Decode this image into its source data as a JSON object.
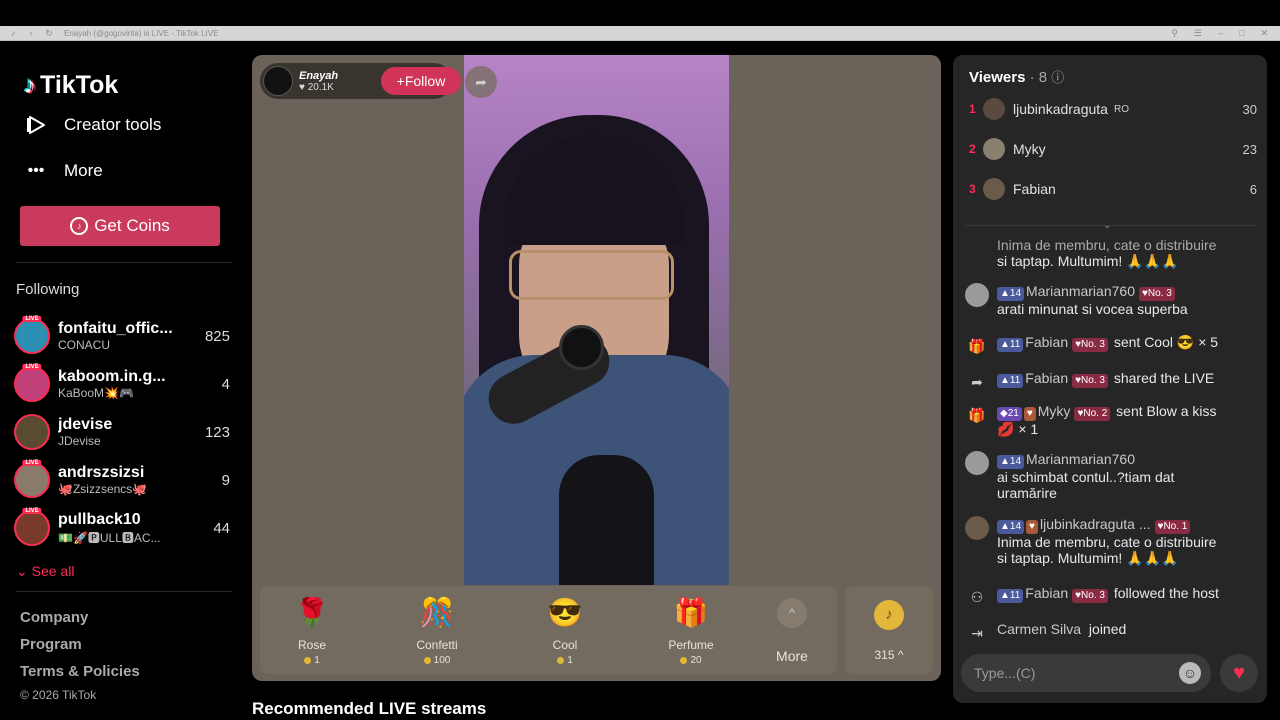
{
  "browser": {
    "tab_title": "TikTok",
    "url": "Enayah (@gogovirita) is LIVE - TikTok LIVE"
  },
  "sidebar": {
    "logo": "TikTok",
    "nav": [
      {
        "label": "Creator tools",
        "icon": "creator-tools-icon"
      },
      {
        "label": "More",
        "icon": "more-dots-icon"
      }
    ],
    "get_coins": "Get Coins",
    "following_title": "Following",
    "following": [
      {
        "name": "fonfaitu_offic...",
        "sub": "CONACU",
        "count": "825"
      },
      {
        "name": "kaboom.in.g...",
        "sub": "KaBooM💥🎮",
        "count": "4"
      },
      {
        "name": "jdevise",
        "sub": "JDevise",
        "count": "123"
      },
      {
        "name": "andrszsizsi",
        "sub": "🐙Zsizzsencs🐙",
        "count": "9"
      },
      {
        "name": "pullback10",
        "sub": "💵🚀🅿ULL🅱AC...",
        "count": "44"
      }
    ],
    "live_tag": "LIVE",
    "see_all": "See all",
    "footer": [
      "Company",
      "Program",
      "Terms & Policies"
    ],
    "copyright": "© 2026 TikTok"
  },
  "player": {
    "host_name": "Enayah",
    "host_likes": "20.1K",
    "follow": "+Follow"
  },
  "gifts": [
    {
      "name": "Rose",
      "price": "1",
      "icon": "🌹"
    },
    {
      "name": "Confetti",
      "price": "100",
      "icon": "🎊"
    },
    {
      "name": "Cool",
      "price": "1",
      "icon": "😎"
    },
    {
      "name": "Perfume",
      "price": "20",
      "icon": "🎁"
    }
  ],
  "more_gifts": "More",
  "coin_balance": "315",
  "recommended_title": "Recommended LIVE streams",
  "viewers": {
    "title": "Viewers",
    "count": "8",
    "list": [
      {
        "rank": "1",
        "name": "ljubinkadraguta",
        "flag": "RO",
        "score": "30"
      },
      {
        "rank": "2",
        "name": "Myky",
        "score": "23"
      },
      {
        "rank": "3",
        "name": "Fabian",
        "score": "6"
      }
    ]
  },
  "chat": {
    "m0": {
      "text": "Inima de membru, cate o distribuire",
      "text2": "si taptap. Multumim! 🙏🙏🙏"
    },
    "m1": {
      "level": "14",
      "user": "Marianmarian760",
      "rank": "No. 3",
      "text": "arati minunat si vocea superba"
    },
    "m2": {
      "level": "11",
      "user": "Fabian",
      "rank": "No. 3",
      "text": "sent Cool 😎 × 5"
    },
    "m3": {
      "level": "11",
      "user": "Fabian",
      "rank": "No. 3",
      "text": "shared the LIVE"
    },
    "m4": {
      "level": "21",
      "user": "Myky",
      "rank": "No. 2",
      "text": "sent Blow a kiss",
      "text2": "💋 × 1"
    },
    "m5": {
      "level": "14",
      "user": "Marianmarian760",
      "text": "ai schimbat contul..?tiam dat",
      "text2": "uramărire"
    },
    "m6": {
      "level": "14",
      "user": "ljubinkadraguta ...",
      "rank": "No. 1",
      "text": "Inima de membru, cate o distribuire",
      "text2": "si taptap. Multumim! 🙏🙏🙏"
    },
    "m7": {
      "level": "11",
      "user": "Fabian",
      "rank": "No. 3",
      "text": "followed the host"
    },
    "m8": {
      "user": "Carmen Silva",
      "text": "joined"
    }
  },
  "input_placeholder": "Type...(C)"
}
